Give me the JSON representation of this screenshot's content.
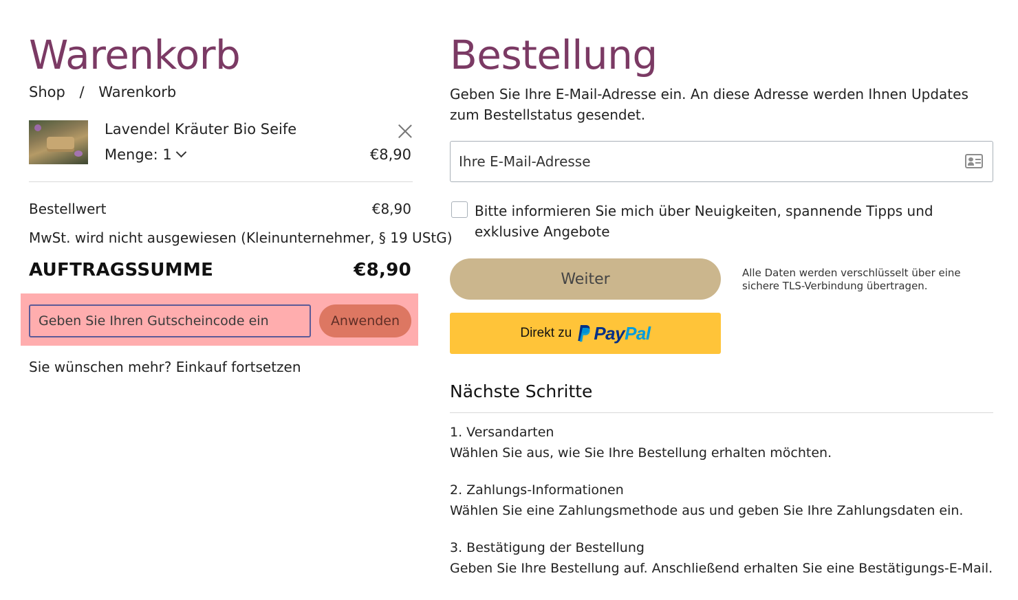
{
  "cart": {
    "title": "Warenkorb",
    "breadcrumb": {
      "shop": "Shop",
      "separator": "/",
      "current": "Warenkorb"
    },
    "item": {
      "name": "Lavendel Kräuter Bio Seife",
      "quantity_label": "Menge: 1",
      "price": "€8,90",
      "image_icon": "product-thumbnail"
    },
    "order_value_label": "Bestellwert",
    "order_value": "€8,90",
    "tax_note": "MwSt. wird nicht ausgewiesen (Kleinunternehmer, § 19 UStG)",
    "total_label": "AUFTRAGSSUMME",
    "total_value": "€8,90",
    "coupon": {
      "placeholder": "Geben Sie Ihren Gutscheincode ein",
      "apply_label": "Anwenden",
      "highlight_color": "#ffadae"
    },
    "continue_prefix": "Sie wünschen mehr?",
    "continue_link": "Einkauf fortsetzen"
  },
  "order": {
    "title": "Bestellung",
    "email_description": "Geben Sie Ihre E-Mail-Adresse ein. An diese Adresse werden Ihnen Updates zum Bestellstatus gesendet.",
    "email_placeholder": "Ihre E-Mail-Adresse",
    "newsletter_label": "Bitte informieren Sie mich über Neuigkeiten, spannende Tipps und exklusive Angebote",
    "newsletter_checked": false,
    "continue_button": "Weiter",
    "secure_note": "Alle Daten werden verschlüsselt über eine sichere TLS-Verbindung übertragen.",
    "paypal_prefix": "Direkt zu",
    "paypal_word_pay": "Pay",
    "paypal_word_pal": "Pal",
    "next_steps_title": "Nächste Schritte",
    "steps": [
      {
        "title": "1. Versandarten",
        "text": "Wählen Sie aus, wie Sie Ihre Bestellung erhalten möchten."
      },
      {
        "title": "2. Zahlungs-Informationen",
        "text": "Wählen Sie eine Zahlungsmethode aus und geben Sie Ihre Zahlungsdaten ein."
      },
      {
        "title": "3. Bestätigung der Bestellung",
        "text": "Geben Sie Ihre Bestellung auf. Anschließend erhalten Sie eine Bestätigungs-E-Mail."
      }
    ]
  },
  "colors": {
    "title": "#7b3a64",
    "weiter_button": "#cbb68d",
    "apply_button": "#dd7762",
    "paypal_button": "#ffc439",
    "paypal_dark": "#003087",
    "paypal_light": "#009cde"
  }
}
